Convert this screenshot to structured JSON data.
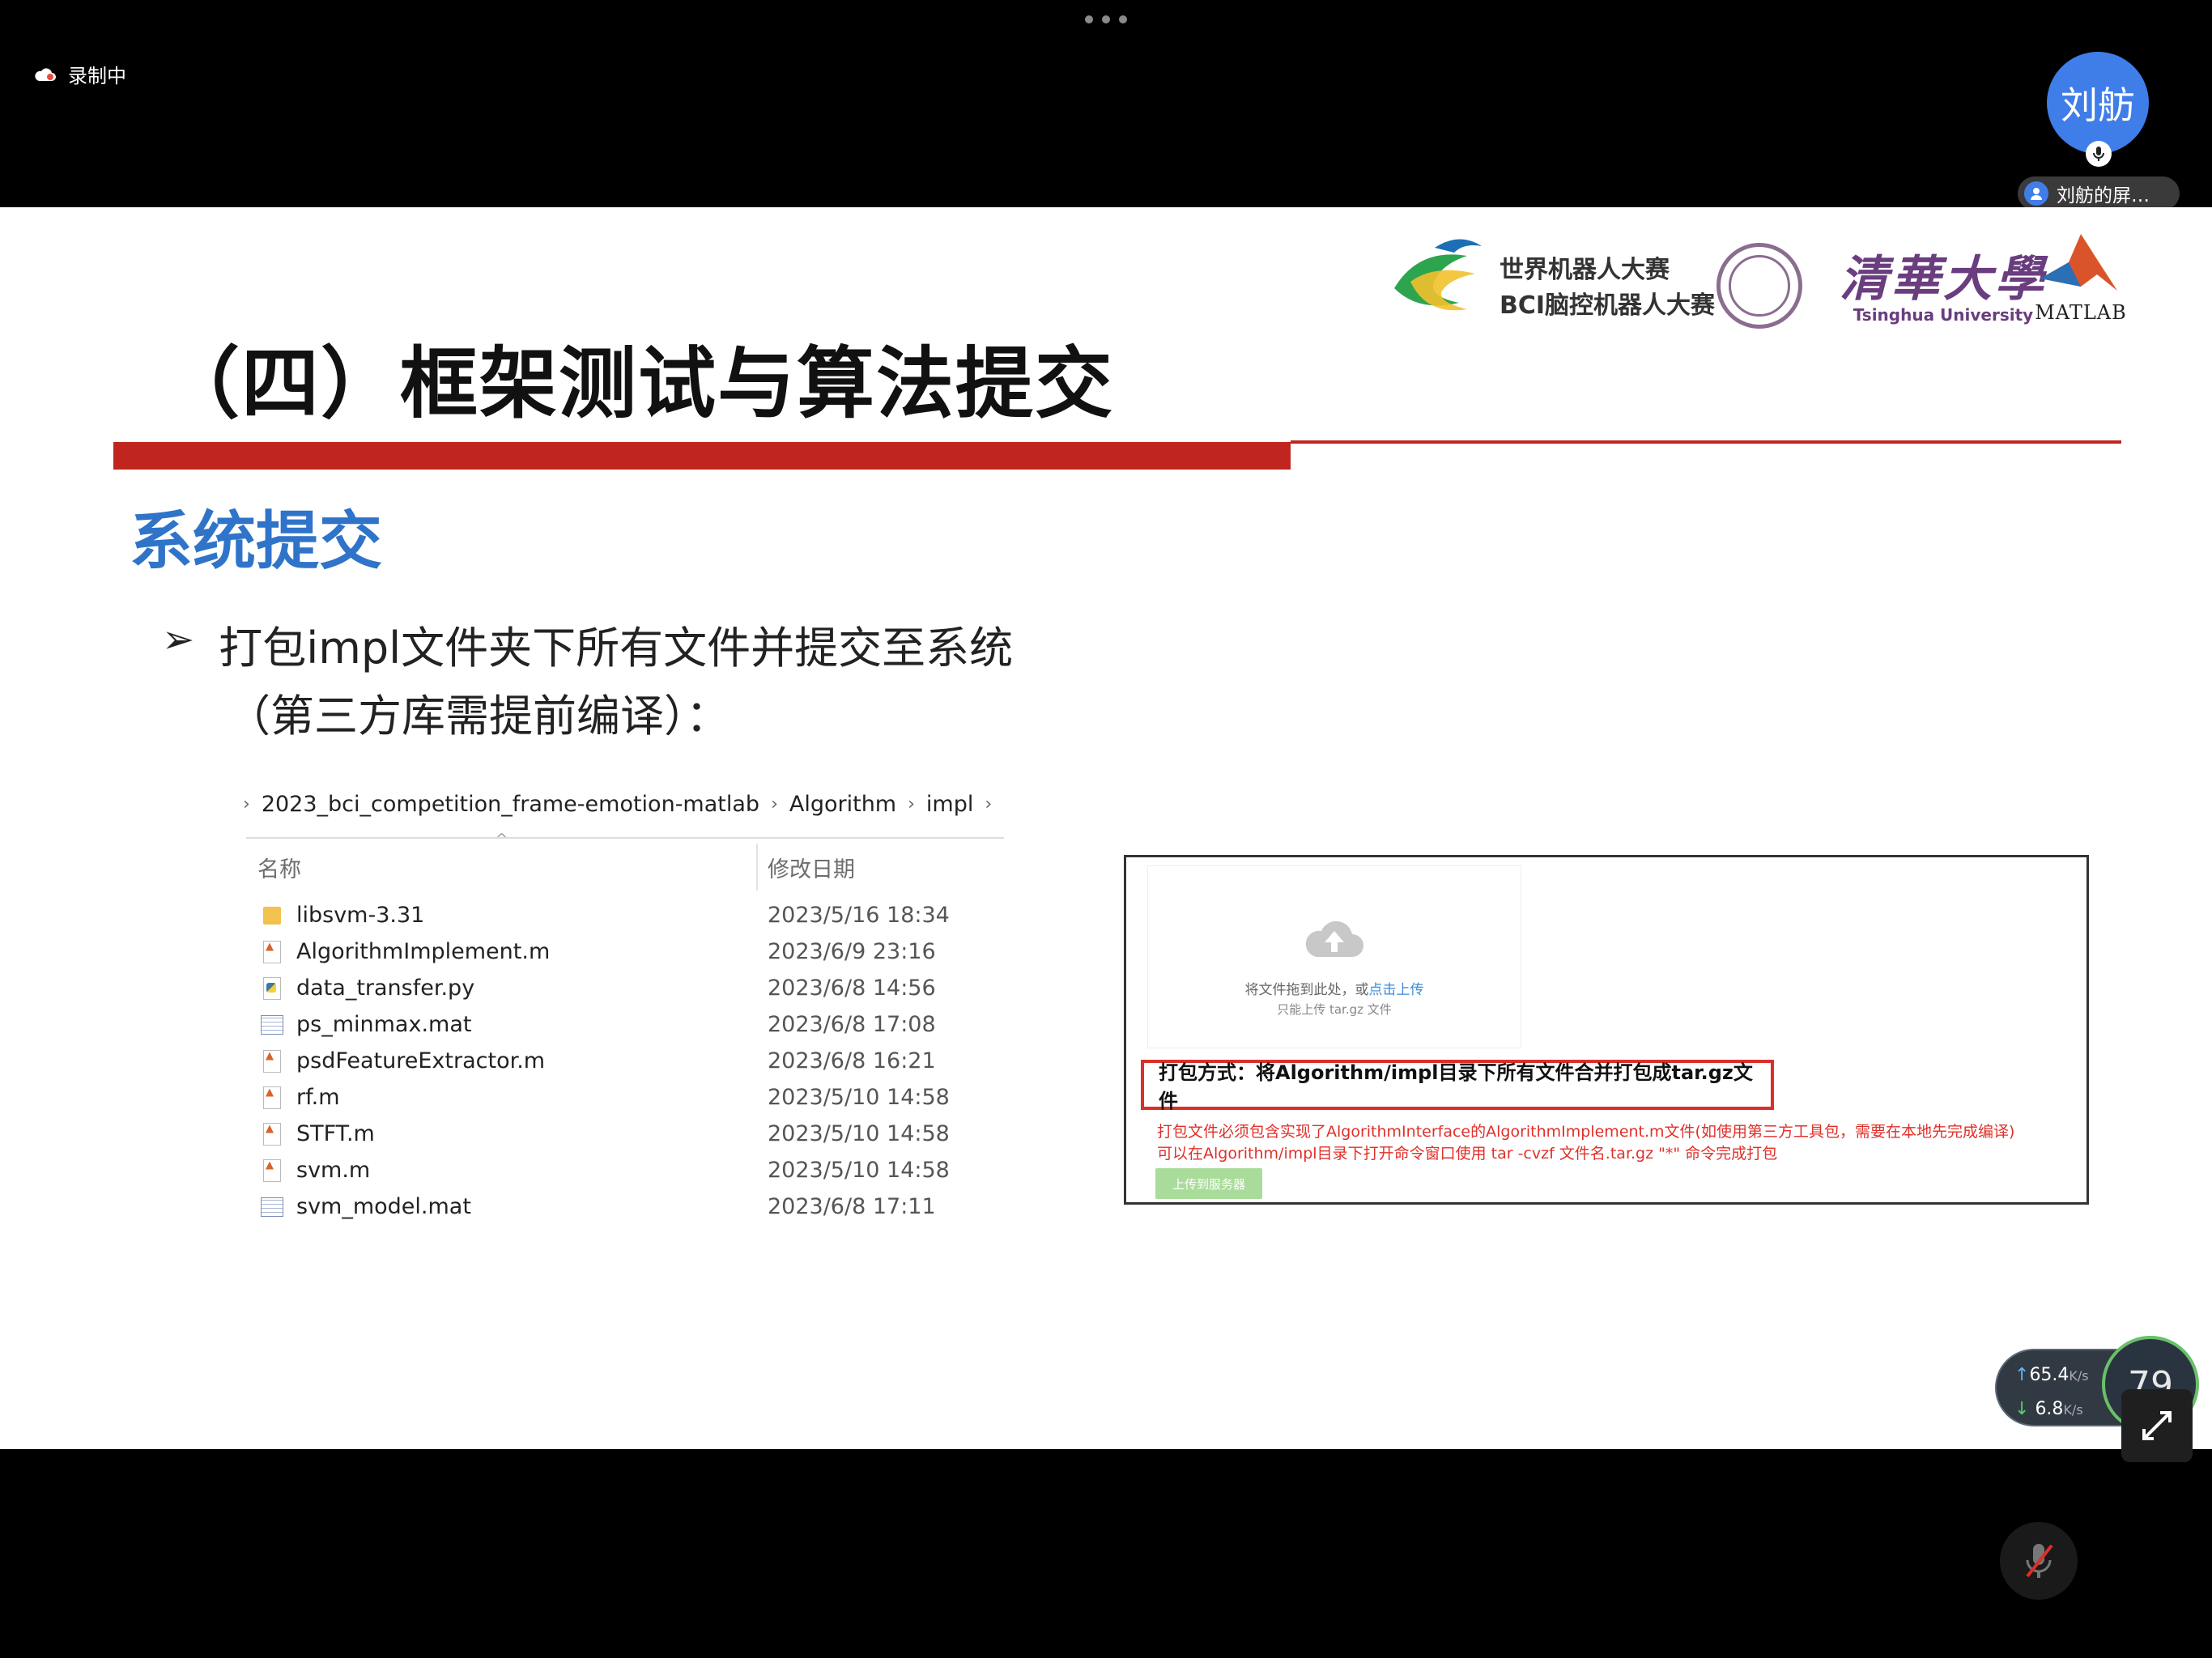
{
  "recording": {
    "label": "录制中",
    "icon": "cloud-icon"
  },
  "participant": {
    "avatar_text": "刘舫",
    "share_label": "刘舫的屏…"
  },
  "slide": {
    "title": "（四）框架测试与算法提交",
    "section_heading": "系统提交",
    "bullet_line1": "打包impl文件夹下所有文件并提交至系统",
    "bullet_line2": "（第三方库需提前编译）：",
    "logos": {
      "wrc_line1": "世界机器人大赛",
      "wrc_line2": "BCI脑控机器人大赛",
      "tsinghua_cn": "清華大學",
      "tsinghua_en": "Tsinghua University",
      "matlab": "MATLAB"
    },
    "accent_color": "#c0261f",
    "heading_color": "#2f74c9"
  },
  "explorer": {
    "breadcrumb": [
      "2023_bci_competition_frame-emotion-matlab",
      "Algorithm",
      "impl"
    ],
    "columns": {
      "name": "名称",
      "date": "修改日期"
    },
    "files": [
      {
        "name": "libsvm-3.31",
        "date": "2023/5/16 18:34",
        "icon": "folder-icon"
      },
      {
        "name": "AlgorithmImplement.m",
        "date": "2023/6/9 23:16",
        "icon": "matlab-file-icon"
      },
      {
        "name": "data_transfer.py",
        "date": "2023/6/8 14:56",
        "icon": "python-file-icon"
      },
      {
        "name": "ps_minmax.mat",
        "date": "2023/6/8 17:08",
        "icon": "mat-file-icon"
      },
      {
        "name": "psdFeatureExtractor.m",
        "date": "2023/6/8 16:21",
        "icon": "matlab-file-icon"
      },
      {
        "name": "rf.m",
        "date": "2023/5/10 14:58",
        "icon": "matlab-file-icon"
      },
      {
        "name": "STFT.m",
        "date": "2023/5/10 14:58",
        "icon": "matlab-file-icon"
      },
      {
        "name": "svm.m",
        "date": "2023/5/10 14:58",
        "icon": "matlab-file-icon"
      },
      {
        "name": "svm_model.mat",
        "date": "2023/6/8 17:11",
        "icon": "mat-file-icon"
      }
    ]
  },
  "upload": {
    "drop_text": "将文件拖到此处，或",
    "drop_link": "点击上传",
    "drop_sub": "只能上传 tar.gz 文件",
    "pack_instruction": "打包方式：将Algorithm/impl目录下所有文件合并打包成tar.gz文件",
    "note_line1": "打包文件必须包含实现了AlgorithmInterface的AlgorithmImplement.m文件(如使用第三方工具包，需要在本地先完成编译)",
    "note_line2": "可以在Algorithm/impl目录下打开命令窗口使用 tar -cvzf 文件名.tar.gz \"*\" 命令完成打包",
    "button_label": "上传到服务器"
  },
  "network": {
    "up": "65.4",
    "down": "6.8",
    "unit": "K/s",
    "gauge": "79"
  }
}
